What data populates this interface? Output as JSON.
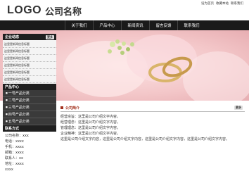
{
  "header": {
    "logo": "LOGO",
    "company_name": "公司名称",
    "links": [
      "设为首页",
      "收藏本站",
      "联系我们"
    ]
  },
  "nav": [
    "关于我们",
    "产品中心",
    "新闻资讯",
    "留言反馈",
    "联系我们"
  ],
  "sidebar": {
    "news_title": "企业动态",
    "news_more": "更多",
    "news_items": [
      "这里是新闻信息标题",
      "这里是新闻信息标题",
      "这里是新闻信息标题",
      "这里是新闻信息标题",
      "这里是新闻信息标题",
      "这里是新闻信息标题"
    ],
    "products_title": "产品中心",
    "products": [
      "一号产品分类",
      "二号产品分类",
      "三号产品分类",
      "四号产品分类",
      "五号产品分类"
    ],
    "contact_title": "联系方式",
    "contact_lines": [
      "公司名称：xxx",
      "电话：xxxx",
      "手机：xxxx",
      "邮箱：xxxx",
      "联系人：xx",
      "地址：xxxx",
      "xxxx"
    ]
  },
  "intro": {
    "title": "公司简介",
    "more": "更多",
    "paragraphs": [
      "经营宗旨：这里是公司介绍文字内容。",
      "经营理念：这里是公司介绍文字内容。",
      "管理理念：这里是公司介绍文字内容。",
      "企业精神：这里是公司介绍文字内容。",
      "这里是公司介绍文字内容，这里是公司介绍文字内容，这里是公司介绍文字内容，这里是公司介绍文字内容。"
    ]
  },
  "colors": {
    "nav_bg": "#1a1a1a",
    "accent": "#a3321e",
    "banner_pink": "#f3c6c8"
  }
}
